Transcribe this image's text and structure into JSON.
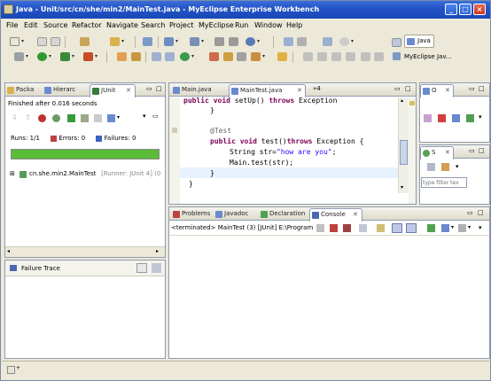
{
  "window": {
    "title": "Java - Unit/src/cn/she/min2/MainTest.java - MyEclipse Enterprise Workbench",
    "controls": {
      "minimize": "_",
      "maximize": "□",
      "close": "×"
    }
  },
  "menu": [
    "File",
    "Edit",
    "Source",
    "Refactor",
    "Navigate",
    "Search",
    "Project",
    "MyEclipse",
    "Run",
    "Window",
    "Help"
  ],
  "perspectives": {
    "java_label": "Java",
    "myeclipse_label": "MyEclipse Jav..."
  },
  "left_panel": {
    "tabs": [
      "Packa",
      "Hierarc",
      "JUnit"
    ],
    "finished_text": "Finished after 0.016 seconds",
    "runs_label": "Runs:",
    "runs_value": "1/1",
    "errors_label": "Errors:",
    "errors_value": "0",
    "failures_label": "Failures:",
    "failures_value": "0",
    "progress_color": "#5bbc3a",
    "test_item": "cn.she.min2.MainTest",
    "test_runner": "[Runner: JUnit 4] (0",
    "failure_trace_label": "Failure Trace"
  },
  "editor": {
    "tabs": [
      "Main.java",
      "MainTest.java"
    ],
    "overflow": "»4",
    "lines": [
      {
        "type": "mixed",
        "parts": [
          [
            "kw",
            "public void "
          ],
          [
            "",
            "setUp() "
          ],
          [
            "kw",
            "throws "
          ],
          [
            "",
            "Exception"
          ]
        ]
      },
      {
        "type": "plain",
        "text": "}"
      },
      {
        "type": "plain",
        "text": ""
      },
      {
        "type": "ann",
        "text": "@Test"
      },
      {
        "type": "mixed",
        "parts": [
          [
            "kw",
            "public void "
          ],
          [
            "",
            "test()"
          ],
          [
            "kw",
            "throws "
          ],
          [
            "",
            "Exception {"
          ]
        ]
      },
      {
        "type": "mixed",
        "parts": [
          [
            "",
            "String str="
          ],
          [
            "str",
            "\"how are you\""
          ],
          [
            "",
            ";"
          ]
        ]
      },
      {
        "type": "plain",
        "text": "Main.test(str);"
      },
      {
        "type": "plain",
        "text": "}"
      },
      {
        "type": "plain",
        "text": "}"
      }
    ]
  },
  "right_top": {
    "tab": "O"
  },
  "right_mid": {
    "tab": "S",
    "filter_placeholder": "type filter tex"
  },
  "bottom_panel": {
    "tabs": [
      "Problems",
      "Javadoc",
      "Declaration",
      "Console"
    ],
    "terminated_text": "<terminated> MainTest (3) [JUnit] E:\\Program"
  }
}
